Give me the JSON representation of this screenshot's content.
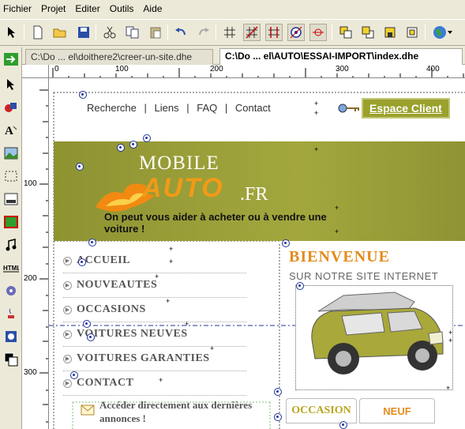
{
  "menu": [
    "Fichier",
    "Projet",
    "Editer",
    "Outils",
    "Aide"
  ],
  "tabs": [
    {
      "label": "C:\\Do ... el\\doithere2\\creer-un-site.dhe",
      "active": false
    },
    {
      "label": "C:\\Do ... el\\AUTO\\ESSAI-IMPORT\\index.dhe",
      "active": true
    }
  ],
  "ruler": {
    "h_labels": [
      "0",
      "100",
      "200",
      "300",
      "400"
    ],
    "v_labels": [
      "100",
      "200",
      "300"
    ]
  },
  "page": {
    "topnav": [
      "Recherche",
      "|",
      "Liens",
      "|",
      "FAQ",
      "|",
      "Contact"
    ],
    "espace_client": "Espace Client",
    "logo_mobile": "MOBILE",
    "logo_auto": "AUTO",
    "logo_fr": ".FR",
    "tagline": "On peut vous aider à acheter ou à vendre une voiture !",
    "left_menu": [
      "ACCUEIL",
      "NOUVEAUTES",
      "OCCASIONS",
      "VOITURES NEUVES",
      "VOITURES GARANTIES",
      "CONTACT"
    ],
    "access_text": "Accéder directement aux dernières annonces !",
    "bienvenue": "BIENVENUE",
    "subtitle": "SUR NOTRE SITE INTERNET",
    "tab_occasion": "OCCASION",
    "tab_neuf": "NEUF"
  },
  "colors": {
    "banner": "#8f9434",
    "accent_orange": "#e38b1c",
    "espace_btn": "#9aa12c",
    "guide_blue": "#223399"
  }
}
